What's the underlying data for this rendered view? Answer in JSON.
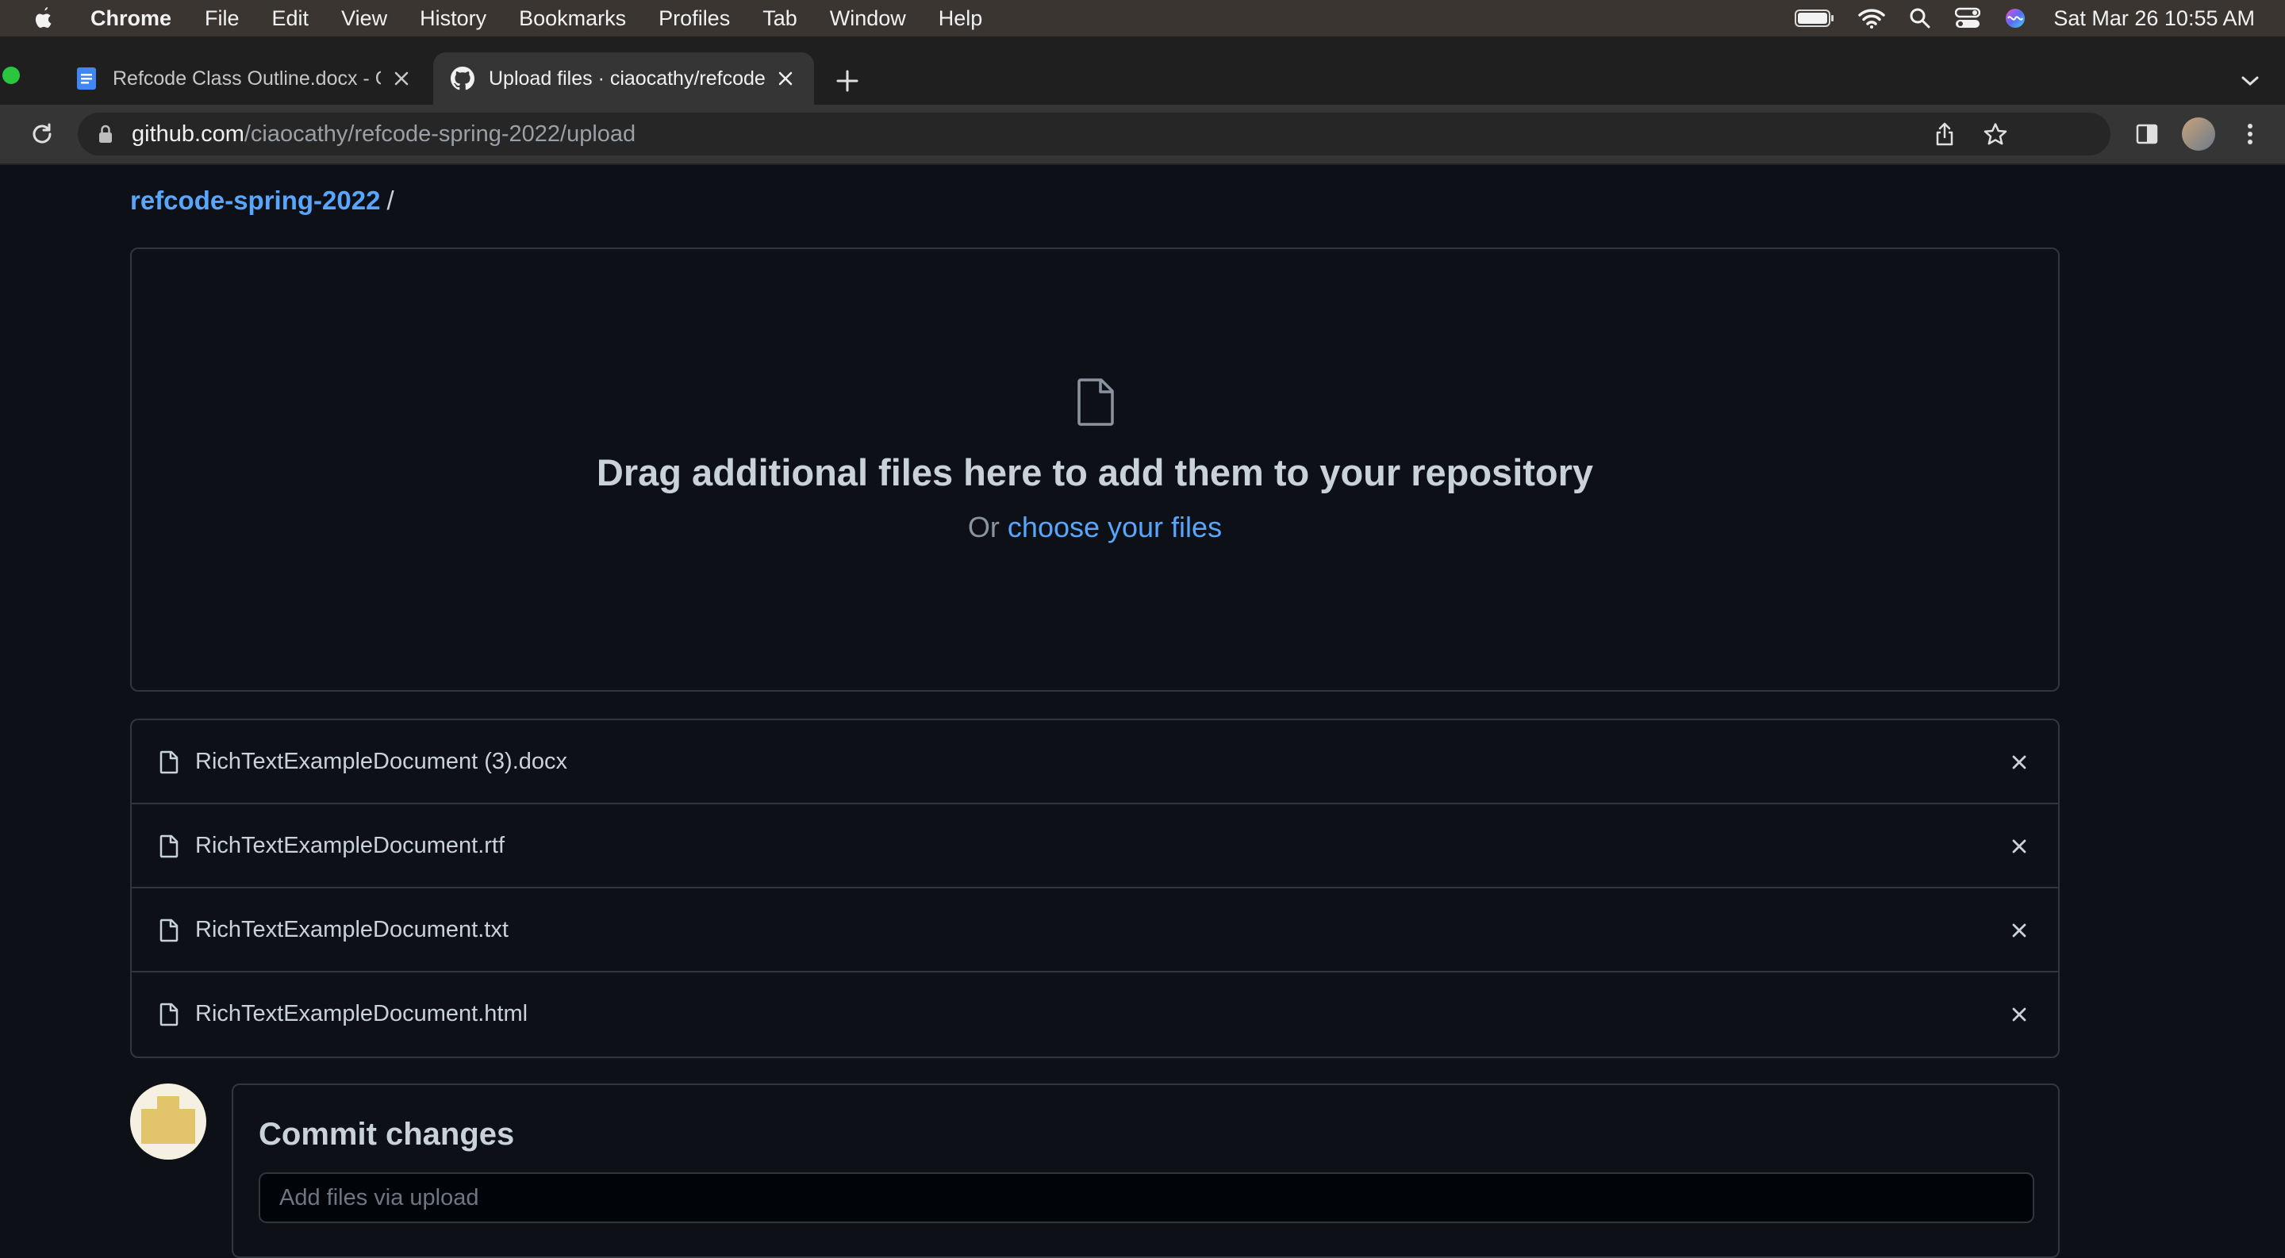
{
  "menubar": {
    "app_name": "Chrome",
    "items": [
      "File",
      "Edit",
      "View",
      "History",
      "Bookmarks",
      "Profiles",
      "Tab",
      "Window",
      "Help"
    ],
    "clock": "Sat Mar 26  10:55 AM"
  },
  "tabs": [
    {
      "title": "Refcode Class Outline.docx - G",
      "active": false,
      "favicon": "google-docs-icon"
    },
    {
      "title": "Upload files · ciaocathy/refcode",
      "active": true,
      "favicon": "github-icon"
    }
  ],
  "address_bar": {
    "host": "github.com",
    "path": "/ciaocathy/refcode-spring-2022/upload"
  },
  "breadcrumb": {
    "repo": "refcode-spring-2022",
    "separator": "/"
  },
  "dropzone": {
    "headline": "Drag additional files here to add them to your repository",
    "prefix": "Or ",
    "link": "choose your files"
  },
  "files": [
    {
      "name": "RichTextExampleDocument (3).docx"
    },
    {
      "name": "RichTextExampleDocument.rtf"
    },
    {
      "name": "RichTextExampleDocument.txt"
    },
    {
      "name": "RichTextExampleDocument.html"
    }
  ],
  "commit": {
    "title": "Commit changes",
    "placeholder": "Add files via upload"
  },
  "colors": {
    "page_bg": "#0d1117",
    "link": "#58a6ff",
    "border": "#30363d"
  }
}
